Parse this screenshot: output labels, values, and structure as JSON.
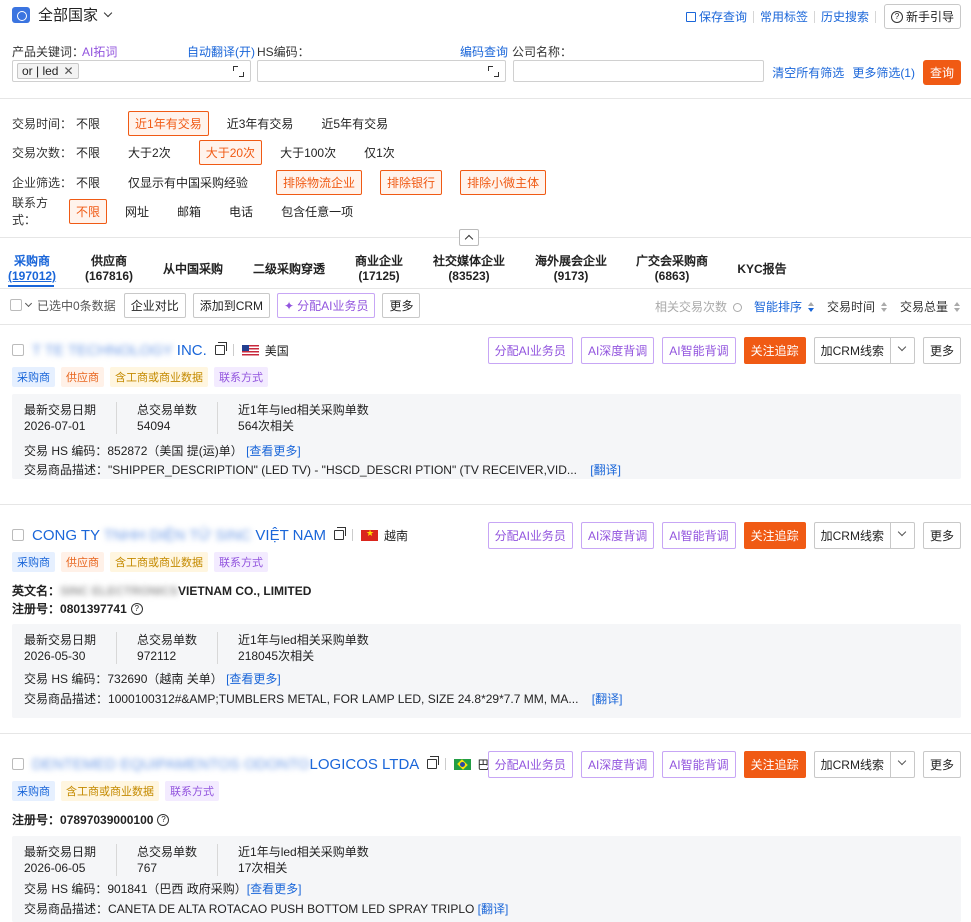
{
  "header": {
    "country_selector": "全部国家",
    "links": [
      "保存查询",
      "常用标签",
      "历史搜索"
    ],
    "guide": "新手引导"
  },
  "search": {
    "product_label": "产品关键词：",
    "ai_words": "AI拓词",
    "auto_translate": "自动翻译(开)",
    "hs_label": "HS编码：",
    "hs_lookup": "编码查询",
    "company_label": "公司名称：",
    "product_tag": "or | led",
    "clear_all": "清空所有筛选",
    "more_filters": "更多筛选(1)",
    "query": "查询"
  },
  "filters": [
    {
      "label": "交易时间：",
      "options": [
        "不限",
        "近1年有交易",
        "近3年有交易",
        "近5年有交易"
      ],
      "selected": [
        1
      ]
    },
    {
      "label": "交易次数：",
      "options": [
        "不限",
        "大于2次",
        "大于20次",
        "大于100次",
        "仅1次"
      ],
      "selected": [
        2
      ]
    },
    {
      "label": "企业筛选：",
      "options": [
        "不限",
        "仅显示有中国采购经验",
        "排除物流企业",
        "排除银行",
        "排除小微主体"
      ],
      "selected": [
        2,
        3,
        4
      ]
    },
    {
      "label": "联系方式：",
      "options": [
        "不限",
        "网址",
        "邮箱",
        "电话",
        "包含任意一项"
      ],
      "selected": [
        0
      ]
    }
  ],
  "tabs": [
    {
      "name": "采购商",
      "count": "(197012)"
    },
    {
      "name": "供应商",
      "count": "(167816)"
    },
    {
      "name": "从中国采购",
      "count": ""
    },
    {
      "name": "二级采购穿透",
      "count": ""
    },
    {
      "name": "商业企业",
      "count": "(17125)"
    },
    {
      "name": "社交媒体企业",
      "count": "(83523)"
    },
    {
      "name": "海外展会企业",
      "count": "(9173)"
    },
    {
      "name": "广交会采购商",
      "count": "(6863)"
    },
    {
      "name": "KYC报告",
      "count": ""
    }
  ],
  "toolbar": {
    "selected_text": "已选中0条数据",
    "compare": "企业对比",
    "add_crm": "添加到CRM",
    "assign_ai": "分配AI业务员",
    "more": "更多",
    "sort_related": "相关交易次数",
    "sort_smart": "智能排序",
    "sort_time": "交易时间",
    "sort_total": "交易总量"
  },
  "card_actions": {
    "assign_ai": "分配AI业务员",
    "deep_check": "AI深度背调",
    "smart_check": "AI智能背调",
    "follow": "关注追踪",
    "add_crm": "加CRM线索",
    "more": "更多"
  },
  "stat_labels": {
    "latest_date": "最新交易日期",
    "total_orders": "总交易单数",
    "recent_related": "近1年与led相关采购单数",
    "hs_code": "交易 HS 编码：",
    "desc": "交易商品描述：",
    "see_more": "[查看更多]",
    "translate": "[翻译]",
    "english_name": "英文名：",
    "reg_no": "注册号："
  },
  "cards": [
    {
      "name_blur": "T    TE TECHNOLOGY",
      "name_suffix": " INC.",
      "name_prefix": "",
      "country": "美国",
      "badges": [
        "采购商",
        "供应商",
        "含工商或商业数据",
        "联系方式"
      ],
      "latest_date": "2026-07-01",
      "total_orders": "54094",
      "recent_related": "564次相关",
      "hs": "852872（美国 提(运)单）",
      "desc": "\"SHIPPER_DESCRIPTION\" (LED TV) - \"HSCD_DESCRI PTION\" (TV RECEIVER,VID..."
    },
    {
      "name_prefix": "CONG TY",
      "name_blur": " TNHH DIỆN TỬ SINC ",
      "name_suffix": "VIỆT NAM",
      "country": "越南",
      "badges": [
        "采购商",
        "供应商",
        "含工商或商业数据",
        "联系方式"
      ],
      "english_name_blur": "SINC ELECTRONICS ",
      "english_name": "VIETNAM CO., LIMITED",
      "reg_no": "0801397741",
      "latest_date": "2026-05-30",
      "total_orders": "972112",
      "recent_related": "218045次相关",
      "hs": "732690（越南 关单）",
      "desc": "1000100312#&AMP;TUMBLERS METAL, FOR LAMP LED, SIZE 24.8*29*7.7 MM, MA..."
    },
    {
      "name_prefix": "",
      "name_blur": "DENTEMED EQUIPAMENTOS ODONTO",
      "name_suffix": "LOGICOS LTDA",
      "country": "巴西",
      "badges": [
        "采购商",
        "含工商或商业数据",
        "联系方式"
      ],
      "reg_no": "07897039000100",
      "latest_date": "2026-06-05",
      "total_orders": "767",
      "recent_related": "17次相关",
      "hs": "901841（巴西 政府采购）",
      "desc": "CANETA DE ALTA ROTACAO PUSH BOTTOM LED SPRAY TRIPLO"
    }
  ]
}
